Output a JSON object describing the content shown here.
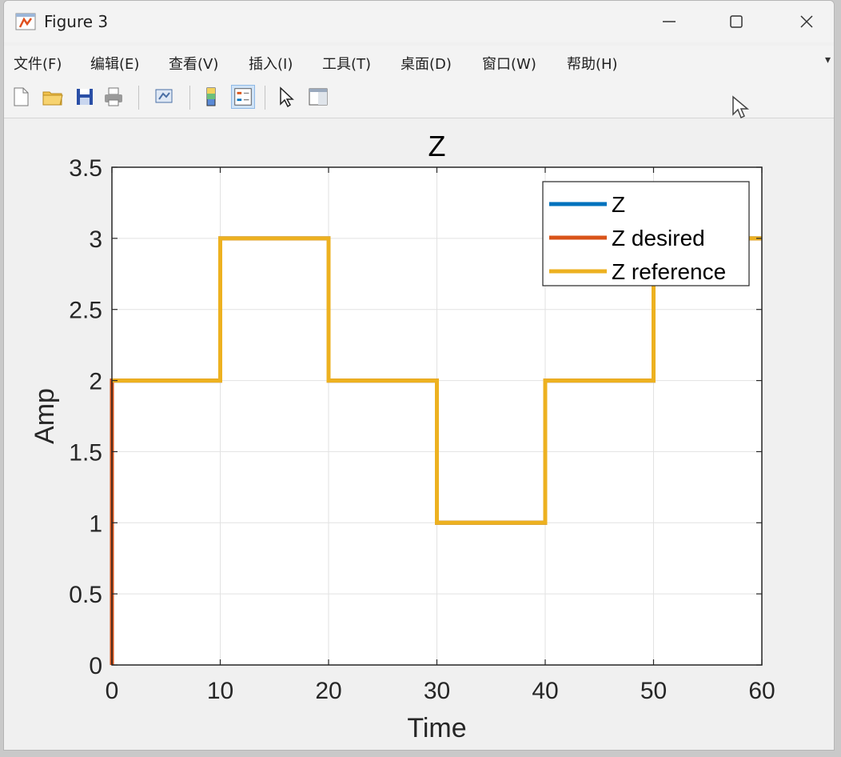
{
  "window": {
    "title": "Figure 3",
    "accent": "#f0f0f0"
  },
  "menu": {
    "items": [
      "文件(F)",
      "编辑(E)",
      "查看(V)",
      "插入(I)",
      "工具(T)",
      "桌面(D)",
      "窗口(W)",
      "帮助(H)"
    ]
  },
  "toolbar": {
    "buttons": [
      "new-figure-icon",
      "open-file-icon",
      "save-icon",
      "print-icon",
      "link-plot-icon",
      "colorbar-icon",
      "legend-icon",
      "edit-plot-icon",
      "property-inspector-icon"
    ]
  },
  "chart_data": {
    "type": "line",
    "title": "Z",
    "xlabel": "Time",
    "ylabel": "Amp",
    "xlim": [
      0,
      60
    ],
    "ylim": [
      0,
      3.5
    ],
    "xticks": [
      "0",
      "10",
      "20",
      "30",
      "40",
      "50",
      "60"
    ],
    "yticks": [
      "0",
      "0.5",
      "1",
      "1.5",
      "2",
      "2.5",
      "3",
      "3.5"
    ],
    "grid": true,
    "legend_position": "top-right",
    "series": [
      {
        "name": "Z",
        "color": "#0072bd",
        "x": [
          0,
          0,
          10,
          10,
          20,
          20,
          30,
          30,
          40,
          40,
          50,
          50,
          60
        ],
        "y": [
          0,
          2,
          2,
          3,
          3,
          2,
          2,
          1,
          1,
          2,
          2,
          3,
          3
        ]
      },
      {
        "name": "Z desired",
        "color": "#d95319",
        "x": [
          0,
          0,
          10,
          10,
          20,
          20,
          30,
          30,
          40,
          40,
          50,
          50,
          60
        ],
        "y": [
          0,
          2,
          2,
          3,
          3,
          2,
          2,
          1,
          1,
          2,
          2,
          3,
          3
        ]
      },
      {
        "name": "Z reference",
        "color": "#edb120",
        "x": [
          0,
          10,
          10,
          20,
          20,
          30,
          30,
          40,
          40,
          50,
          50,
          60
        ],
        "y": [
          2,
          2,
          3,
          3,
          2,
          2,
          1,
          1,
          2,
          2,
          3,
          3
        ]
      }
    ]
  }
}
